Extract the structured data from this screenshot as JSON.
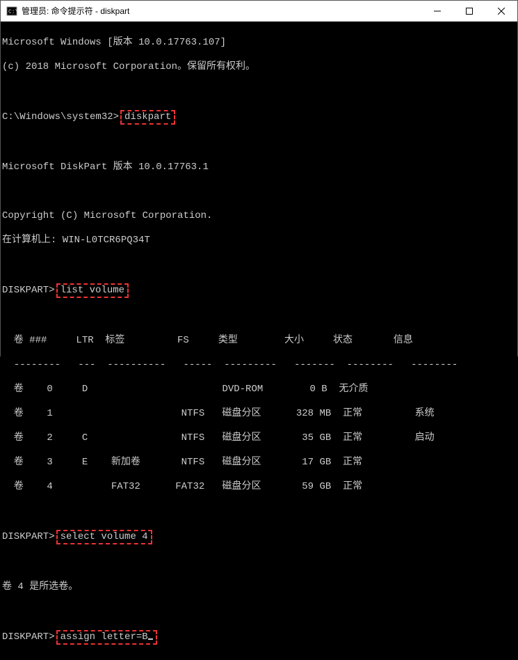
{
  "window": {
    "title": "管理员: 命令提示符 - diskpart"
  },
  "terminal": {
    "banner1": "Microsoft Windows [版本 10.0.17763.107]",
    "banner2": "(c) 2018 Microsoft Corporation。保留所有权利。",
    "prompt1_pre": "C:\\Windows\\system32>",
    "cmd1": "diskpart",
    "diskpart_banner": "Microsoft DiskPart 版本 10.0.17763.1",
    "copyright": "Copyright (C) Microsoft Corporation.",
    "computer": "在计算机上: WIN-L0TCR6PQ34T",
    "prompt2_pre": "DISKPART>",
    "cmd2": "list volume",
    "table_header": "  卷 ###     LTR  标签         FS     类型        大小     状态       信息",
    "table_rule": "  --------   ---  ----------   -----  ---------   -------  --------   --------",
    "rows": [
      "  卷    0     D                       DVD-ROM        0 B  无介质",
      "  卷    1                      NTFS   磁盘分区      328 MB  正常         系统",
      "  卷    2     C                NTFS   磁盘分区       35 GB  正常         启动",
      "  卷    3     E    新加卷       NTFS   磁盘分区       17 GB  正常",
      "  卷    4          FAT32      FAT32   磁盘分区       59 GB  正常"
    ],
    "prompt3_pre": "DISKPART>",
    "cmd3": "select volume 4",
    "selected_msg": "卷 4 是所选卷。",
    "prompt4_pre": "DISKPART>",
    "cmd4": "assign letter=B"
  },
  "chart_data": {
    "type": "table",
    "title": "diskpart list volume",
    "columns": [
      "卷 ###",
      "LTR",
      "标签",
      "FS",
      "类型",
      "大小",
      "状态",
      "信息"
    ],
    "rows": [
      {
        "卷 ###": "卷 0",
        "LTR": "D",
        "标签": "",
        "FS": "",
        "类型": "DVD-ROM",
        "大小": "0 B",
        "状态": "无介质",
        "信息": ""
      },
      {
        "卷 ###": "卷 1",
        "LTR": "",
        "标签": "",
        "FS": "NTFS",
        "类型": "磁盘分区",
        "大小": "328 MB",
        "状态": "正常",
        "信息": "系统"
      },
      {
        "卷 ###": "卷 2",
        "LTR": "C",
        "标签": "",
        "FS": "NTFS",
        "类型": "磁盘分区",
        "大小": "35 GB",
        "状态": "正常",
        "信息": "启动"
      },
      {
        "卷 ###": "卷 3",
        "LTR": "E",
        "标签": "新加卷",
        "FS": "NTFS",
        "类型": "磁盘分区",
        "大小": "17 GB",
        "状态": "正常",
        "信息": ""
      },
      {
        "卷 ###": "卷 4",
        "LTR": "",
        "标签": "FAT32",
        "FS": "FAT32",
        "类型": "磁盘分区",
        "大小": "59 GB",
        "状态": "正常",
        "信息": ""
      }
    ]
  }
}
